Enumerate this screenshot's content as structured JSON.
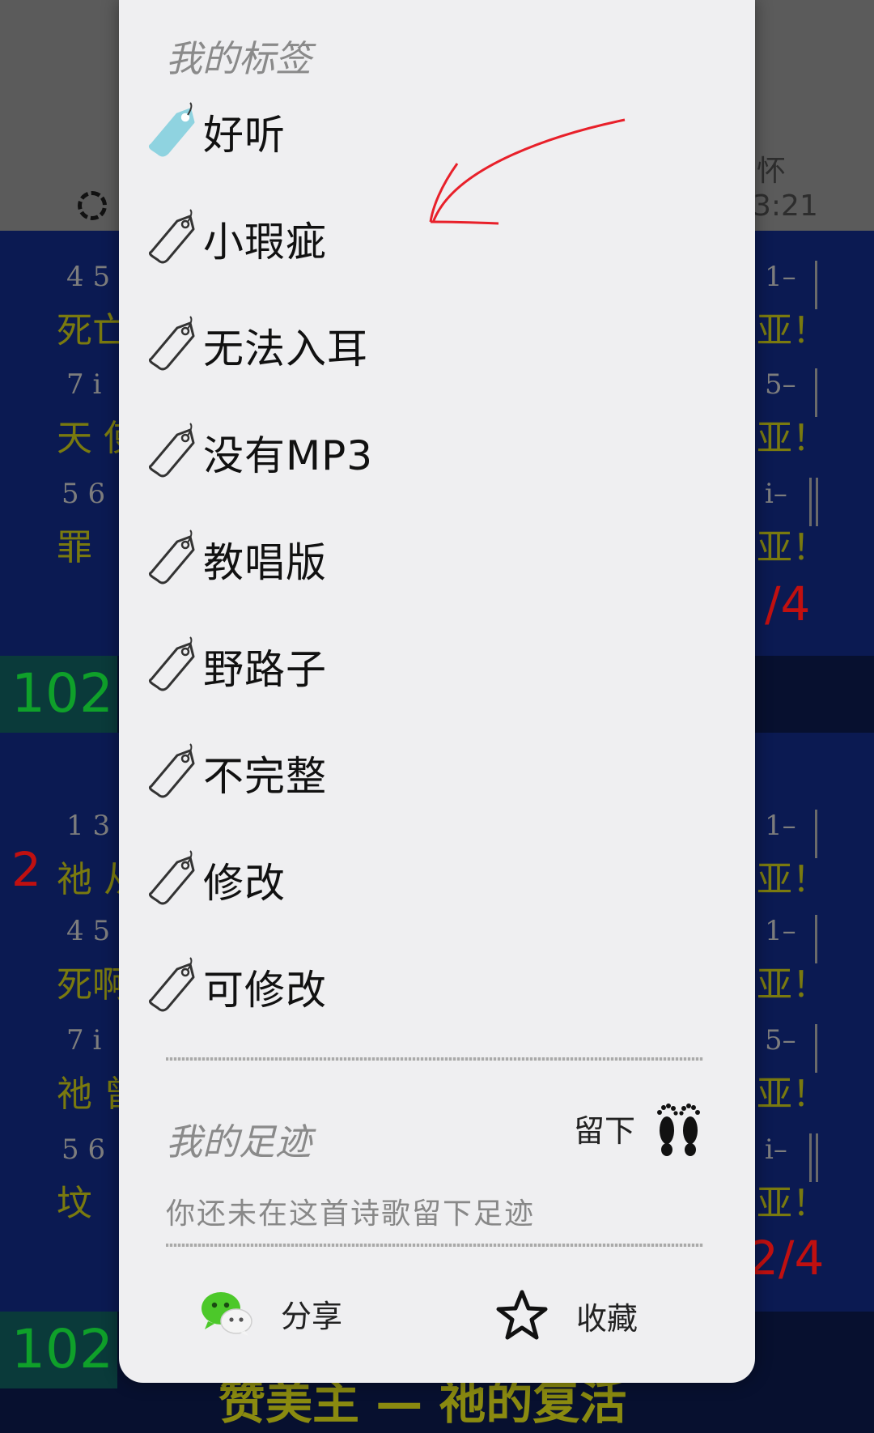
{
  "background": {
    "top_right_char": "怀",
    "top_right_time": "3:21",
    "hymn_number_1": "102",
    "hymn_number_2": "102",
    "verse_number": "2",
    "bottom_title": "赞美主 — 祂的复活",
    "meter_1": "/4",
    "meter_2": "2/4",
    "right_lyric": "亚！"
  },
  "sheet": {
    "tags_title": "我的标签",
    "tags": [
      {
        "label": "好听",
        "selected": true
      },
      {
        "label": "小瑕疵",
        "selected": false
      },
      {
        "label": "无法入耳",
        "selected": false
      },
      {
        "label": "没有MP3",
        "selected": false
      },
      {
        "label": "教唱版",
        "selected": false
      },
      {
        "label": "野路子",
        "selected": false
      },
      {
        "label": "不完整",
        "selected": false
      },
      {
        "label": "修改",
        "selected": false
      },
      {
        "label": "可修改",
        "selected": false
      }
    ],
    "footprints_title": "我的足迹",
    "leave_label": "留下",
    "empty_message": "你还未在这首诗歌留下足迹",
    "share_label": "分享",
    "favorite_label": "收藏"
  },
  "colors": {
    "selected_tag": "#8fd3e0",
    "annotation": "#e8202a",
    "wechat_green": "#4cc82a"
  },
  "icons": {
    "tag": "tag-icon",
    "footprints": "footprints-icon",
    "share": "wechat-icon",
    "favorite": "star-icon"
  }
}
